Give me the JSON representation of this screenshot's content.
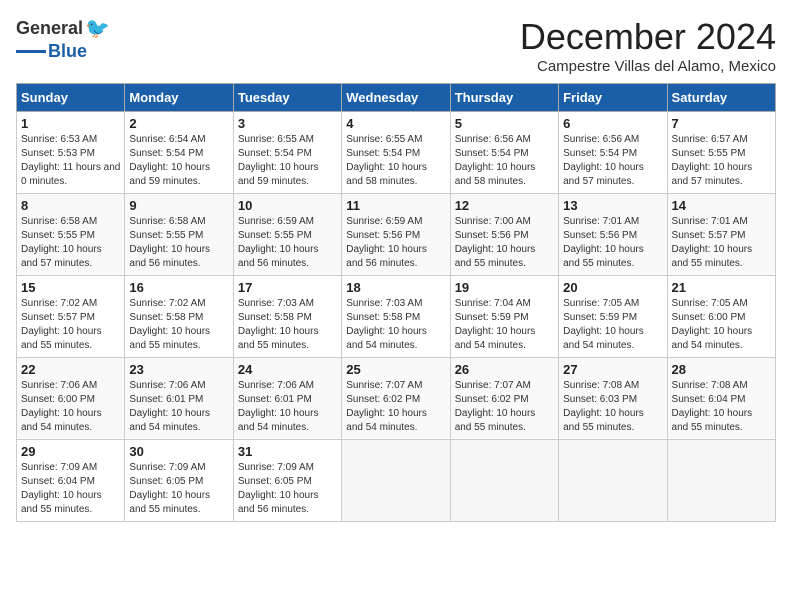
{
  "logo": {
    "general": "General",
    "blue": "Blue",
    "tagline": ""
  },
  "title": "December 2024",
  "subtitle": "Campestre Villas del Alamo, Mexico",
  "headers": [
    "Sunday",
    "Monday",
    "Tuesday",
    "Wednesday",
    "Thursday",
    "Friday",
    "Saturday"
  ],
  "weeks": [
    [
      {
        "day": "1",
        "sunrise": "Sunrise: 6:53 AM",
        "sunset": "Sunset: 5:53 PM",
        "daylight": "Daylight: 11 hours and 0 minutes."
      },
      {
        "day": "2",
        "sunrise": "Sunrise: 6:54 AM",
        "sunset": "Sunset: 5:54 PM",
        "daylight": "Daylight: 10 hours and 59 minutes."
      },
      {
        "day": "3",
        "sunrise": "Sunrise: 6:55 AM",
        "sunset": "Sunset: 5:54 PM",
        "daylight": "Daylight: 10 hours and 59 minutes."
      },
      {
        "day": "4",
        "sunrise": "Sunrise: 6:55 AM",
        "sunset": "Sunset: 5:54 PM",
        "daylight": "Daylight: 10 hours and 58 minutes."
      },
      {
        "day": "5",
        "sunrise": "Sunrise: 6:56 AM",
        "sunset": "Sunset: 5:54 PM",
        "daylight": "Daylight: 10 hours and 58 minutes."
      },
      {
        "day": "6",
        "sunrise": "Sunrise: 6:56 AM",
        "sunset": "Sunset: 5:54 PM",
        "daylight": "Daylight: 10 hours and 57 minutes."
      },
      {
        "day": "7",
        "sunrise": "Sunrise: 6:57 AM",
        "sunset": "Sunset: 5:55 PM",
        "daylight": "Daylight: 10 hours and 57 minutes."
      }
    ],
    [
      {
        "day": "8",
        "sunrise": "Sunrise: 6:58 AM",
        "sunset": "Sunset: 5:55 PM",
        "daylight": "Daylight: 10 hours and 57 minutes."
      },
      {
        "day": "9",
        "sunrise": "Sunrise: 6:58 AM",
        "sunset": "Sunset: 5:55 PM",
        "daylight": "Daylight: 10 hours and 56 minutes."
      },
      {
        "day": "10",
        "sunrise": "Sunrise: 6:59 AM",
        "sunset": "Sunset: 5:55 PM",
        "daylight": "Daylight: 10 hours and 56 minutes."
      },
      {
        "day": "11",
        "sunrise": "Sunrise: 6:59 AM",
        "sunset": "Sunset: 5:56 PM",
        "daylight": "Daylight: 10 hours and 56 minutes."
      },
      {
        "day": "12",
        "sunrise": "Sunrise: 7:00 AM",
        "sunset": "Sunset: 5:56 PM",
        "daylight": "Daylight: 10 hours and 55 minutes."
      },
      {
        "day": "13",
        "sunrise": "Sunrise: 7:01 AM",
        "sunset": "Sunset: 5:56 PM",
        "daylight": "Daylight: 10 hours and 55 minutes."
      },
      {
        "day": "14",
        "sunrise": "Sunrise: 7:01 AM",
        "sunset": "Sunset: 5:57 PM",
        "daylight": "Daylight: 10 hours and 55 minutes."
      }
    ],
    [
      {
        "day": "15",
        "sunrise": "Sunrise: 7:02 AM",
        "sunset": "Sunset: 5:57 PM",
        "daylight": "Daylight: 10 hours and 55 minutes."
      },
      {
        "day": "16",
        "sunrise": "Sunrise: 7:02 AM",
        "sunset": "Sunset: 5:58 PM",
        "daylight": "Daylight: 10 hours and 55 minutes."
      },
      {
        "day": "17",
        "sunrise": "Sunrise: 7:03 AM",
        "sunset": "Sunset: 5:58 PM",
        "daylight": "Daylight: 10 hours and 55 minutes."
      },
      {
        "day": "18",
        "sunrise": "Sunrise: 7:03 AM",
        "sunset": "Sunset: 5:58 PM",
        "daylight": "Daylight: 10 hours and 54 minutes."
      },
      {
        "day": "19",
        "sunrise": "Sunrise: 7:04 AM",
        "sunset": "Sunset: 5:59 PM",
        "daylight": "Daylight: 10 hours and 54 minutes."
      },
      {
        "day": "20",
        "sunrise": "Sunrise: 7:05 AM",
        "sunset": "Sunset: 5:59 PM",
        "daylight": "Daylight: 10 hours and 54 minutes."
      },
      {
        "day": "21",
        "sunrise": "Sunrise: 7:05 AM",
        "sunset": "Sunset: 6:00 PM",
        "daylight": "Daylight: 10 hours and 54 minutes."
      }
    ],
    [
      {
        "day": "22",
        "sunrise": "Sunrise: 7:06 AM",
        "sunset": "Sunset: 6:00 PM",
        "daylight": "Daylight: 10 hours and 54 minutes."
      },
      {
        "day": "23",
        "sunrise": "Sunrise: 7:06 AM",
        "sunset": "Sunset: 6:01 PM",
        "daylight": "Daylight: 10 hours and 54 minutes."
      },
      {
        "day": "24",
        "sunrise": "Sunrise: 7:06 AM",
        "sunset": "Sunset: 6:01 PM",
        "daylight": "Daylight: 10 hours and 54 minutes."
      },
      {
        "day": "25",
        "sunrise": "Sunrise: 7:07 AM",
        "sunset": "Sunset: 6:02 PM",
        "daylight": "Daylight: 10 hours and 54 minutes."
      },
      {
        "day": "26",
        "sunrise": "Sunrise: 7:07 AM",
        "sunset": "Sunset: 6:02 PM",
        "daylight": "Daylight: 10 hours and 55 minutes."
      },
      {
        "day": "27",
        "sunrise": "Sunrise: 7:08 AM",
        "sunset": "Sunset: 6:03 PM",
        "daylight": "Daylight: 10 hours and 55 minutes."
      },
      {
        "day": "28",
        "sunrise": "Sunrise: 7:08 AM",
        "sunset": "Sunset: 6:04 PM",
        "daylight": "Daylight: 10 hours and 55 minutes."
      }
    ],
    [
      {
        "day": "29",
        "sunrise": "Sunrise: 7:09 AM",
        "sunset": "Sunset: 6:04 PM",
        "daylight": "Daylight: 10 hours and 55 minutes."
      },
      {
        "day": "30",
        "sunrise": "Sunrise: 7:09 AM",
        "sunset": "Sunset: 6:05 PM",
        "daylight": "Daylight: 10 hours and 55 minutes."
      },
      {
        "day": "31",
        "sunrise": "Sunrise: 7:09 AM",
        "sunset": "Sunset: 6:05 PM",
        "daylight": "Daylight: 10 hours and 56 minutes."
      },
      null,
      null,
      null,
      null
    ]
  ]
}
